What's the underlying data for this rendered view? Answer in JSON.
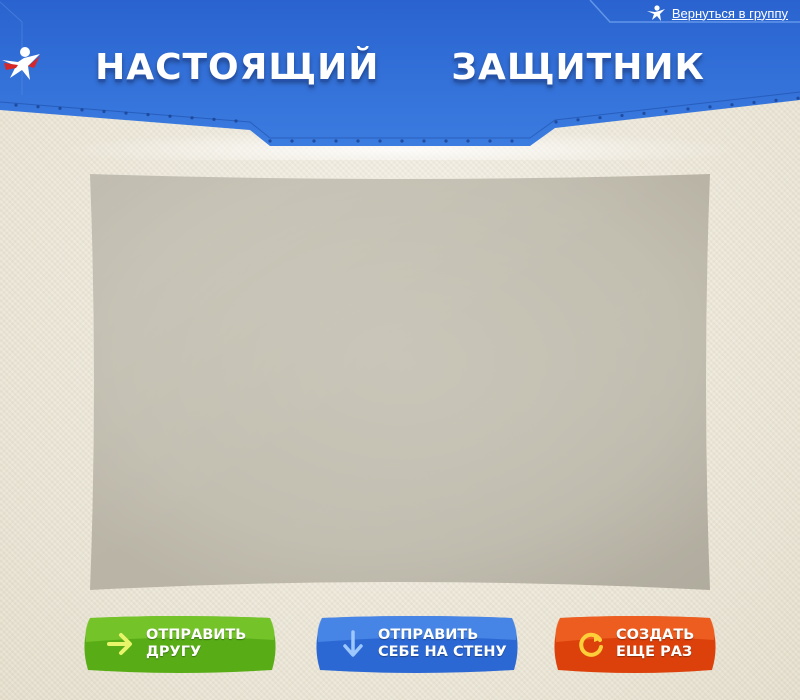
{
  "header": {
    "back_link_label": "Вернуться в группу",
    "title_left": "НАСТОЯЩИЙ",
    "title_right": "ЗАЩИТНИК",
    "colors": {
      "banner": "#2f6fd8",
      "banner_dark": "#1f4fb0"
    }
  },
  "actions": {
    "send_friend": {
      "line1": "ОТПРАВИТЬ",
      "line2": "ДРУГУ",
      "color": "#5fb41f",
      "icon": "arrow-right-icon"
    },
    "post_wall": {
      "line1": "ОТПРАВИТЬ",
      "line2": "СЕБЕ НА СТЕНУ",
      "color": "#2f6fd8",
      "icon": "arrow-down-icon"
    },
    "create_again": {
      "line1": "СОЗДАТЬ",
      "line2": "ЕЩЕ РАЗ",
      "color": "#e0460f",
      "icon": "refresh-icon"
    }
  }
}
